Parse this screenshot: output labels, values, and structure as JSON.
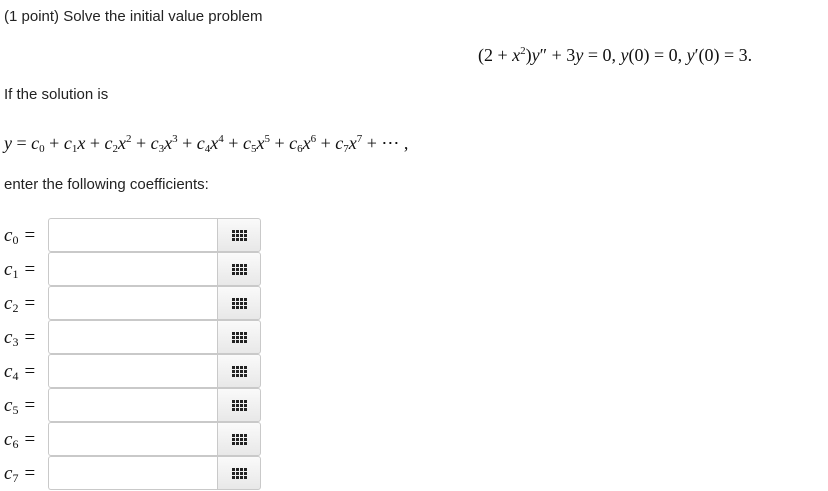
{
  "problem": {
    "header": "(1 point) Solve the initial value problem",
    "if_text": "If the solution is",
    "enter_text": "enter the following coefficients:"
  },
  "coefficients": [
    {
      "letter": "c",
      "index": "0",
      "equals": "="
    },
    {
      "letter": "c",
      "index": "1",
      "equals": "="
    },
    {
      "letter": "c",
      "index": "2",
      "equals": "="
    },
    {
      "letter": "c",
      "index": "3",
      "equals": "="
    },
    {
      "letter": "c",
      "index": "4",
      "equals": "="
    },
    {
      "letter": "c",
      "index": "5",
      "equals": "="
    },
    {
      "letter": "c",
      "index": "6",
      "equals": "="
    },
    {
      "letter": "c",
      "index": "7",
      "equals": "="
    }
  ],
  "inputs": [
    {
      "value": ""
    },
    {
      "value": ""
    },
    {
      "value": ""
    },
    {
      "value": ""
    },
    {
      "value": ""
    },
    {
      "value": ""
    },
    {
      "value": ""
    },
    {
      "value": ""
    }
  ],
  "icons": {
    "keypad": "keypad-grid-icon"
  },
  "colors": {
    "text": "#222222",
    "input_border": "#c9c9c9",
    "button_bg": "#f0f0f0"
  }
}
